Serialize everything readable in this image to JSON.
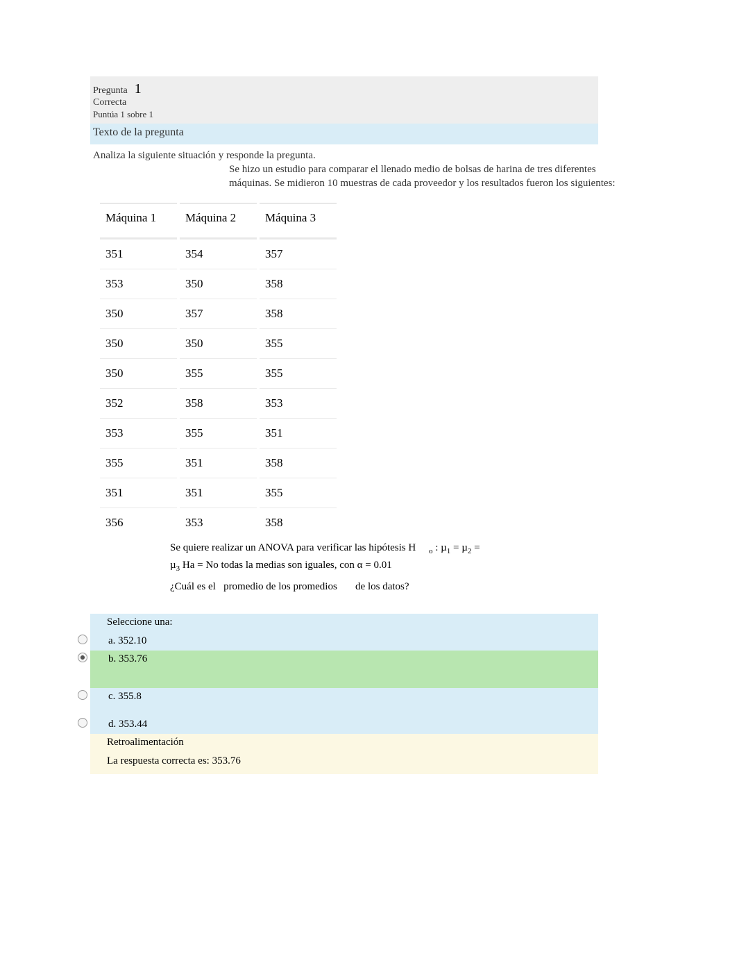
{
  "header": {
    "pregunta_label": "Pregunta",
    "pregunta_num": "1",
    "correcta": "Correcta",
    "puntua": "Puntúa 1 sobre 1"
  },
  "texto_label": "Texto de la pregunta",
  "instruction": "Analiza la siguiente situación y responde la pregunta.",
  "study_desc": "Se hizo un estudio para comparar el llenado medio de bolsas de harina de tres diferentes máquinas. Se midieron 10 muestras de cada proveedor y los resultados fueron los siguientes:",
  "table": {
    "headers": [
      "Máquina 1",
      "Máquina 2",
      "Máquina 3"
    ],
    "rows": [
      [
        "351",
        "354",
        "357"
      ],
      [
        "353",
        "350",
        "358"
      ],
      [
        "350",
        "357",
        "358"
      ],
      [
        "350",
        "350",
        "355"
      ],
      [
        "350",
        "355",
        "355"
      ],
      [
        "352",
        "358",
        "353"
      ],
      [
        "353",
        "355",
        "351"
      ],
      [
        "355",
        "351",
        "358"
      ],
      [
        "351",
        "351",
        "355"
      ],
      [
        "356",
        "353",
        "358"
      ]
    ]
  },
  "hypothesis_line1": "Se quiere realizar un ANOVA para verificar las hipótesis H",
  "hypothesis_sub_o": "o",
  "hypothesis_mu_part": " : µ",
  "hypothesis_sub1": "1",
  "hypothesis_eq1": " = µ",
  "hypothesis_sub2": "2",
  "hypothesis_eq2": " = ",
  "hypothesis_line2_pre": "µ",
  "hypothesis_sub3": "3",
  "hypothesis_line2_post": "  Ha = No todas la medias son iguales, con α = 0.01",
  "prompt": {
    "p1": "¿Cuál es el",
    "p2": "promedio de los promedios",
    "p3": "de los datos?"
  },
  "select_one": "Seleccione una:",
  "options": {
    "a": "a. 352.10",
    "b": "b. 353.76",
    "c": "c. 355.8",
    "d": "d. 353.44"
  },
  "retro_label": "Retroalimentación",
  "retro_body": "La respuesta correcta es: 353.76"
}
